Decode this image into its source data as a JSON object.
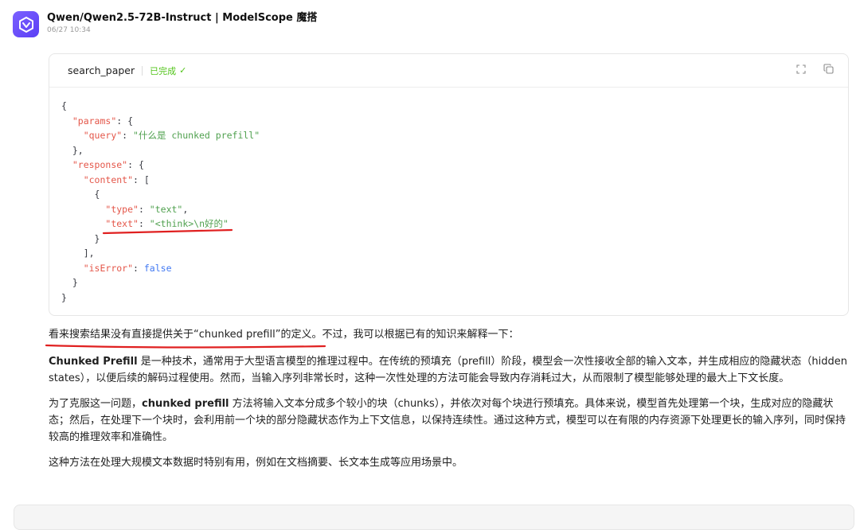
{
  "header": {
    "title": "Qwen/Qwen2.5-72B-Instruct | ModelScope 魔搭",
    "timestamp": "06/27 10:34",
    "avatar_icon": "modelscope-logo-icon"
  },
  "tool_card": {
    "name": "search_paper",
    "status": "已完成",
    "status_icon": "check-icon",
    "status_color": "#52c41a",
    "actions": [
      "fullscreen-icon",
      "copy-icon"
    ],
    "code": {
      "open": "{",
      "params_key": "\"params\"",
      "query_key": "\"query\"",
      "query_val": "\"什么是 chunked prefill\"",
      "params_close": "},",
      "response_key": "\"response\"",
      "content_key": "\"content\"",
      "item_open": "{",
      "type_key": "\"type\"",
      "type_val": "\"text\"",
      "text_key": "\"text\"",
      "text_val": "\"<think>\\n好的\"",
      "item_close": "}",
      "array_close": "],",
      "iserror_key": "\"isError\"",
      "iserror_val": "false",
      "response_close": "}",
      "close": "}"
    }
  },
  "answer": {
    "intro": "看来搜索结果没有直接提供关于“chunked prefill”的定义。不过，我可以根据已有的知识来解释一下：",
    "p2_bold": "Chunked Prefill",
    "p2_text": " 是一种技术，通常用于大型语言模型的推理过程中。在传统的预填充（prefill）阶段，模型会一次性接收全部的输入文本，并生成相应的隐藏状态（hidden states），以便后续的解码过程使用。然而，当输入序列非常长时，这种一次性处理的方法可能会导致内存消耗过大，从而限制了模型能够处理的最大上下文长度。",
    "p3_pre": "为了克服这一问题，",
    "p3_bold": "chunked prefill",
    "p3_text": " 方法将输入文本分成多个较小的块（chunks），并依次对每个块进行预填充。具体来说，模型首先处理第一个块，生成对应的隐藏状态；然后，在处理下一个块时，会利用前一个块的部分隐藏状态作为上下文信息，以保持连续性。通过这种方式，模型可以在有限的内存资源下处理更长的输入序列，同时保持较高的推理效率和准确性。",
    "p4": "这种方法在处理大规模文本数据时特别有用，例如在文档摘要、长文本生成等应用场景中。"
  },
  "annotation_color": "#e02020"
}
